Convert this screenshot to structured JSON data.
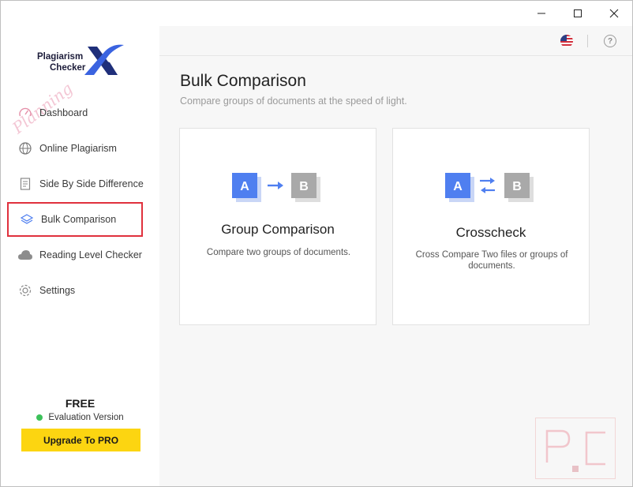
{
  "window": {
    "controls": {
      "minimize": "minimize",
      "maximize": "maximize",
      "close": "close"
    }
  },
  "brand": {
    "line1": "Plagiarism",
    "line2": "Checker",
    "mark": "X",
    "watermark": "Planning"
  },
  "sidebar": {
    "items": [
      {
        "label": "Dashboard",
        "icon": "speedometer-icon"
      },
      {
        "label": "Online Plagiarism",
        "icon": "globe-icon"
      },
      {
        "label": "Side By Side Difference",
        "icon": "document-icon"
      },
      {
        "label": "Bulk Comparison",
        "icon": "layers-icon",
        "active": true
      },
      {
        "label": "Reading Level Checker",
        "icon": "cloud-icon"
      },
      {
        "label": "Settings",
        "icon": "gear-icon"
      }
    ]
  },
  "plan": {
    "tier": "FREE",
    "status": "Evaluation Version",
    "upgrade_label": "Upgrade To PRO"
  },
  "header": {
    "language_icon": "us-flag-icon",
    "help_icon": "help-icon",
    "help_glyph": "?"
  },
  "main": {
    "title": "Bulk Comparison",
    "subtitle": "Compare groups of documents at the speed of light.",
    "cards": [
      {
        "title": "Group Comparison",
        "description": "Compare two groups of documents.",
        "box_a": "A",
        "box_b": "B"
      },
      {
        "title": "Crosscheck",
        "description": "Cross Compare Two files or groups of documents.",
        "box_a": "A",
        "box_b": "B"
      }
    ]
  },
  "colors": {
    "accent_blue": "#4f7ff0",
    "box_gray": "#a9a9a9",
    "active_border": "#e0313d",
    "upgrade_yellow": "#fcd511",
    "status_green": "#3cc15a"
  }
}
